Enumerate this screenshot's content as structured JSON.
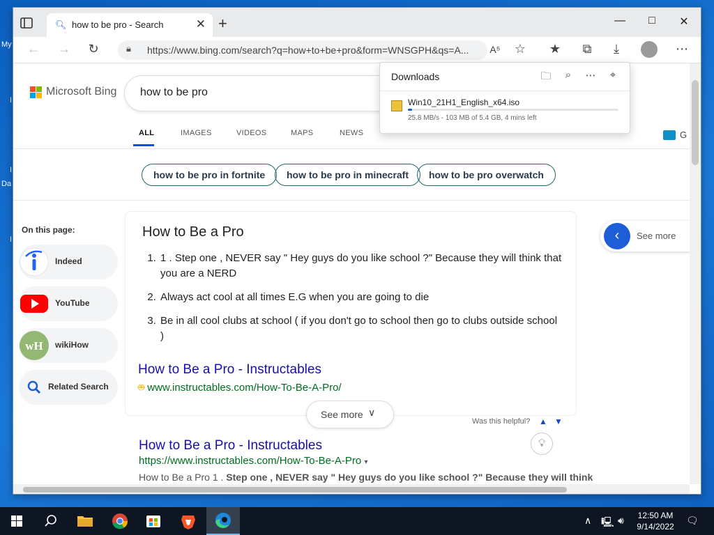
{
  "desktop": {
    "labels": [
      "My",
      "I",
      "I",
      "Da",
      "I"
    ]
  },
  "browser": {
    "tab_title": "how to be pro - Search",
    "url": "https://www.bing.com/search?q=how+to+be+pro&form=WNSGPH&qs=A..."
  },
  "bing": {
    "logo_text": "Microsoft Bing",
    "query": "how to be pro",
    "nav": [
      "ALL",
      "IMAGES",
      "VIDEOS",
      "MAPS",
      "NEWS"
    ],
    "nav_extra_letter": "G",
    "related_pills": [
      "how to be pro in fortnite",
      "how to be pro in minecraft",
      "how to be pro overwatch"
    ],
    "on_this_page": {
      "title": "On this page:",
      "items": [
        "Indeed",
        "YouTube",
        "wikiHow",
        "Related Search"
      ],
      "wikihow_badge": "wH"
    },
    "answer": {
      "title": "How to Be a Pro",
      "steps": [
        "1 . Step one , NEVER say \" Hey guys do you like school ?\" Because they will think that you are a NERD",
        "Always act cool at all times E.G when you are going to die",
        "Be in all cool clubs at school ( if you don't go to school then go to clubs outside school )"
      ],
      "link_title": "How to Be a Pro - Instructables",
      "link_url": "www.instructables.com/How-To-Be-A-Pro/",
      "see_more": "See more",
      "helpful": "Was this helpful?"
    },
    "result2": {
      "title": "How to Be a Pro - Instructables",
      "url": "https://www.instructables.com/How-To-Be-A-Pro",
      "snippet_lead": "How to Be a Pro 1 . ",
      "snippet_bold": "Step one , NEVER say \" Hey guys do you like school ?\" Because they will think"
    },
    "see_more_right": "See more"
  },
  "downloads": {
    "title": "Downloads",
    "file": "Win10_21H1_English_x64.iso",
    "status": "25.8 MB/s - 103 MB of 5.4 GB, 4 mins left",
    "progress": 0.019
  },
  "taskbar": {
    "time": "12:50 AM",
    "date": "9/14/2022"
  },
  "colors": {
    "link": "#1a0dab",
    "url_green": "#006d21",
    "bing_blue": "#174ae4"
  }
}
